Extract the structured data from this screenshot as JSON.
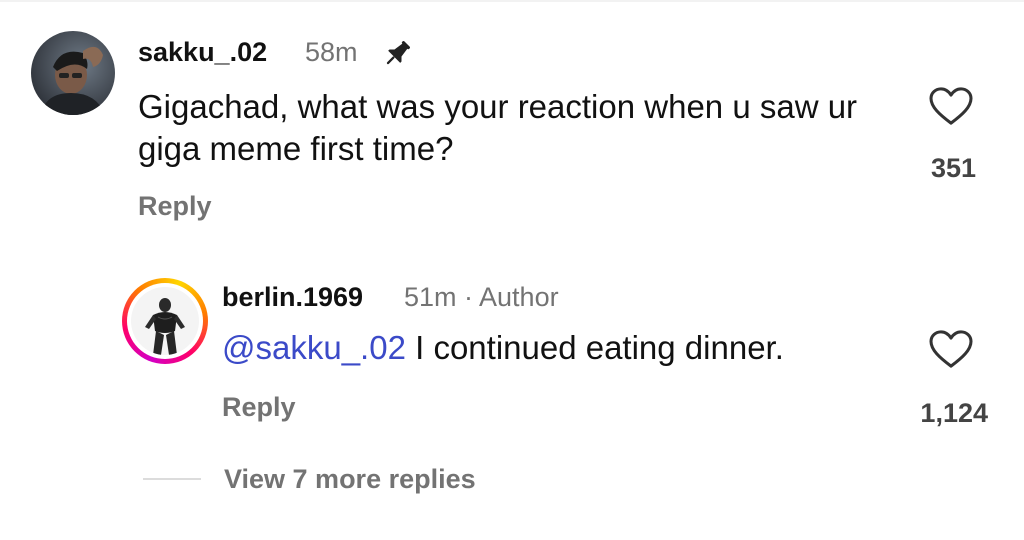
{
  "comments": [
    {
      "username": "sakku_.02",
      "time": "58m",
      "pinned": true,
      "text": "Gigachad, what was your reaction when u saw ur giga meme first time?",
      "reply_label": "Reply",
      "likes": "351"
    }
  ],
  "reply": {
    "username": "berlin.1969",
    "time_author": "51m · Author",
    "mention": "@sakku_.02",
    "text": " I continued eating dinner.",
    "reply_label": "Reply",
    "likes": "1,124"
  },
  "view_more_label": "View 7 more replies",
  "icons": {
    "pin": "pin-icon",
    "like": "heart-icon"
  },
  "colors": {
    "mention": "#3b4ac8",
    "secondary_text": "#737373",
    "story_ring_start": "#d300c5",
    "story_ring_end": "#ffd600"
  }
}
